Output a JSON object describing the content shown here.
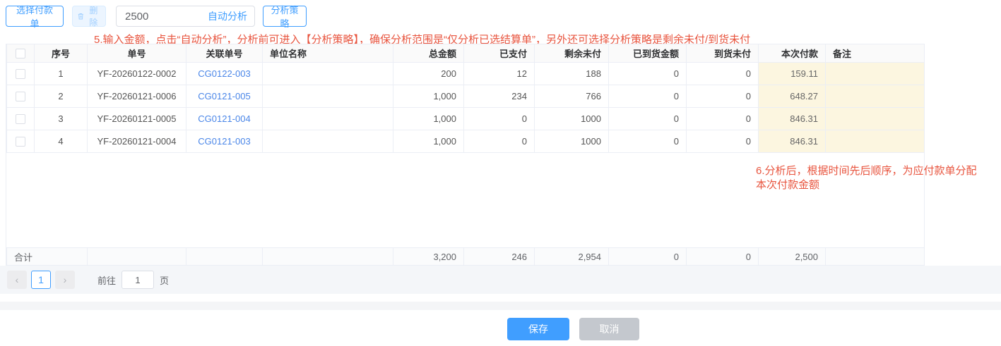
{
  "toolbar": {
    "select_payment_button": "选择付款单",
    "delete_button": "删除",
    "amount_input": "2500",
    "auto_analyze_link": "自动分析",
    "strategy_button": "分析策略"
  },
  "annotations": {
    "step5": "5.输入金额，点击“自动分析”，分析前可进入【分析策略】，确保分析范围是“仅分析已选结算单”，另外还可选择分析策略是剩余未付/到货未付",
    "step6_line1": "6.分析后，根据时间先后顺序，为应付款单分配",
    "step6_line2": "本次付款金额"
  },
  "table": {
    "columns": [
      "序号",
      "单号",
      "关联单号",
      "单位名称",
      "总金额",
      "已支付",
      "剩余未付",
      "已到货金额",
      "到货未付",
      "本次付款",
      "备注"
    ],
    "rows": [
      {
        "seq": "1",
        "doc_no": "YF-20260122-0002",
        "related_no": "CG0122-003",
        "unit_name": "",
        "total": "200",
        "paid": "12",
        "remaining": "188",
        "arrived": "0",
        "arrival_unpaid": "0",
        "current_payment": "159.11",
        "remark": ""
      },
      {
        "seq": "2",
        "doc_no": "YF-20260121-0006",
        "related_no": "CG0121-005",
        "unit_name": "",
        "total": "1,000",
        "paid": "234",
        "remaining": "766",
        "arrived": "0",
        "arrival_unpaid": "0",
        "current_payment": "648.27",
        "remark": ""
      },
      {
        "seq": "3",
        "doc_no": "YF-20260121-0005",
        "related_no": "CG0121-004",
        "unit_name": "",
        "total": "1,000",
        "paid": "0",
        "remaining": "1000",
        "arrived": "0",
        "arrival_unpaid": "0",
        "current_payment": "846.31",
        "remark": ""
      },
      {
        "seq": "4",
        "doc_no": "YF-20260121-0004",
        "related_no": "CG0121-003",
        "unit_name": "",
        "total": "1,000",
        "paid": "0",
        "remaining": "1000",
        "arrived": "0",
        "arrival_unpaid": "0",
        "current_payment": "846.31",
        "remark": ""
      }
    ],
    "summary": {
      "label": "合计",
      "total": "3,200",
      "paid": "246",
      "remaining": "2,954",
      "arrived": "0",
      "arrival_unpaid": "0",
      "current_payment": "2,500",
      "remark": ""
    }
  },
  "pagination": {
    "prev_icon": "‹",
    "page": "1",
    "next_icon": "›",
    "goto_label": "前往",
    "goto_value": "1",
    "page_unit": "页"
  },
  "footer": {
    "save": "保存",
    "cancel": "取消"
  },
  "colors": {
    "accent": "#409eff",
    "link": "#4a86e8",
    "red": "#e8543e",
    "yellow": "#fcf6e0",
    "border": "#ebeef5",
    "header_bg": "#fafafa",
    "summary_bg": "#fafbfc",
    "pager_bg": "#f4f6f9",
    "strip_bg": "#f4f5f7",
    "cancel_bg": "#c4c8ce",
    "delete_bg": "#ecf5ff",
    "delete_border": "#d9ecff",
    "delete_text": "#a0cfff"
  }
}
